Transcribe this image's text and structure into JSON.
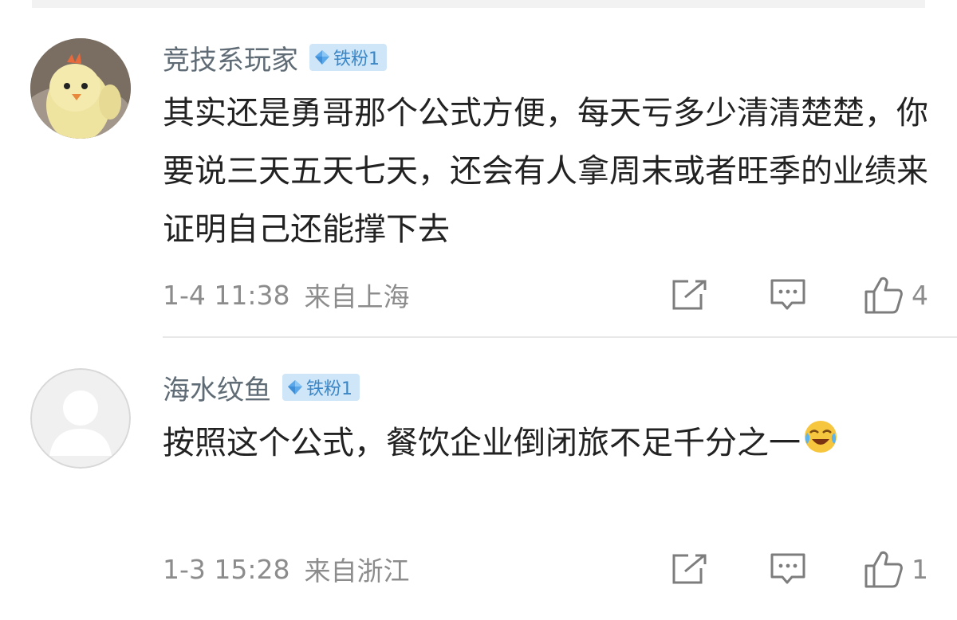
{
  "comments": [
    {
      "username": "竞技系玩家",
      "badge": "铁粉1",
      "avatar_icon": "yellow-chick-avatar",
      "text": "其实还是勇哥那个公式方便，每天亏多少清清楚楚，你要说三天五天七天，还会有人拿周末或者旺季的业绩来证明自己还能撑下去",
      "time": "1-4 11:38",
      "location": "来自上海",
      "likes": "4"
    },
    {
      "username": "海水纹鱼",
      "badge": "铁粉1",
      "avatar_icon": "default-user-avatar",
      "text": "按照这个公式，餐饮企业倒闭旅不足千分之一",
      "emoji_icon": "laugh-cry-emoji",
      "time": "1-3 15:28",
      "location": "来自浙江",
      "likes": "1"
    }
  ],
  "icons": {
    "share": "share-icon",
    "comment": "comment-icon",
    "like": "thumbs-up-icon"
  },
  "colors": {
    "username": "#5f6b75",
    "badge_bg": "#cfe6f8",
    "badge_text": "#3a86c6",
    "meta": "#8c8c8c"
  }
}
